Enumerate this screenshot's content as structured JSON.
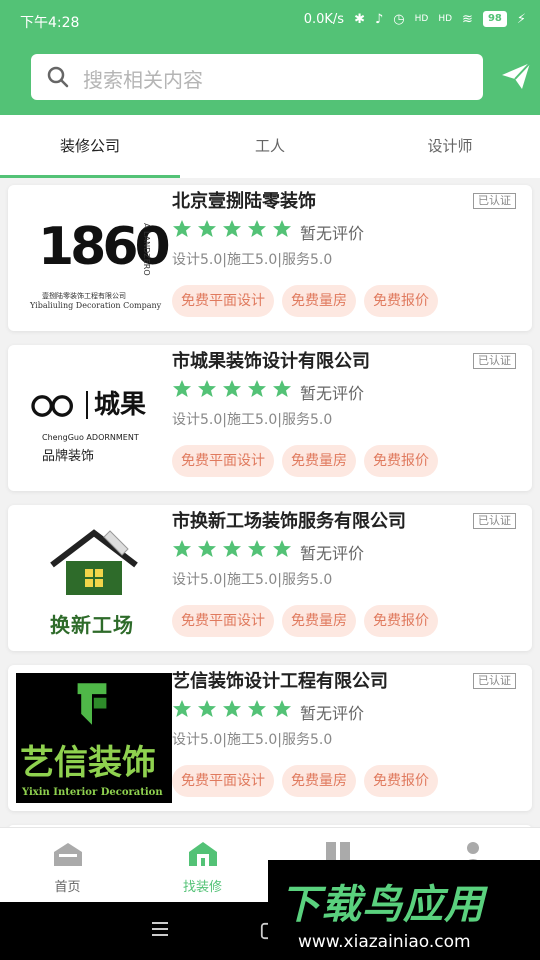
{
  "status_bar": {
    "time": "下午4:28",
    "net_speed": "0.0K/s",
    "signal1": "HD",
    "signal2": "HD",
    "battery": "98"
  },
  "search": {
    "placeholder": "搜索相关内容"
  },
  "tabs": [
    {
      "label": "装修公司",
      "active": true
    },
    {
      "label": "工人",
      "active": false
    },
    {
      "label": "设计师",
      "active": false
    }
  ],
  "companies": [
    {
      "name": "北京壹捌陆零装饰",
      "verified": "已认证",
      "rating_stars": 5,
      "review_text": "暂无评价",
      "scores": "设计5.0|施工5.0|服务5.0",
      "tags": [
        "免费平面设计",
        "免费量房",
        "免费报价"
      ],
      "logo": {
        "big": "1860",
        "side": "A LANDZERO",
        "cn": "壹捌陆零装饰工程有限公司",
        "en": "Yibaliuling Decoration Company"
      }
    },
    {
      "name": "市城果装饰设计有限公司",
      "verified": "已认证",
      "rating_stars": 5,
      "review_text": "暂无评价",
      "scores": "设计5.0|施工5.0|服务5.0",
      "tags": [
        "免费平面设计",
        "免费量房",
        "免费报价"
      ],
      "logo": {
        "mark": "城果",
        "en": "ChengGuo ADORNMENT",
        "cn": "品牌装饰"
      }
    },
    {
      "name": "市换新工场装饰服务有限公司",
      "verified": "已认证",
      "rating_stars": 5,
      "review_text": "暂无评价",
      "scores": "设计5.0|施工5.0|服务5.0",
      "tags": [
        "免费平面设计",
        "免费量房",
        "免费报价"
      ],
      "logo": {
        "cn": "换新工场"
      }
    },
    {
      "name": "艺信装饰设计工程有限公司",
      "verified": "已认证",
      "rating_stars": 5,
      "review_text": "暂无评价",
      "scores": "设计5.0|施工5.0|服务5.0",
      "tags": [
        "免费平面设计",
        "免费量房",
        "免费报价"
      ],
      "logo": {
        "cn": "艺信装饰",
        "en": "Yixin Interior Decoration"
      }
    }
  ],
  "bottom_nav": [
    {
      "label": "首页",
      "icon": "home-icon",
      "active": false
    },
    {
      "label": "找装修",
      "icon": "find-decoration-icon",
      "active": true
    },
    {
      "label": "",
      "icon": "book-icon",
      "active": false
    },
    {
      "label": "",
      "icon": "profile-icon",
      "active": false
    }
  ],
  "watermark": {
    "title": "下载鸟应用",
    "url": "www.xiazainiao.com"
  },
  "colors": {
    "brand": "#53c276",
    "star": "#53c276",
    "tag_bg": "#fde8e1",
    "tag_text": "#e07a5e"
  }
}
